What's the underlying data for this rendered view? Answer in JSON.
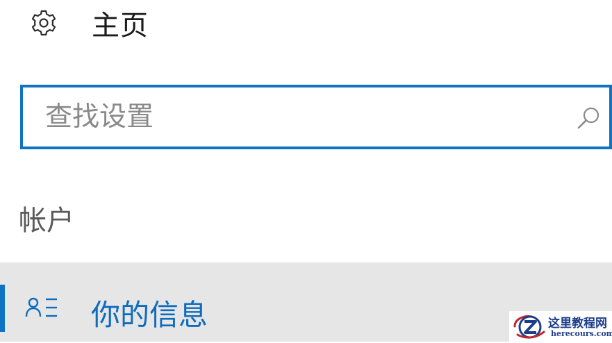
{
  "header": {
    "icon": "gear-icon",
    "title": "主页"
  },
  "search": {
    "placeholder": "查找设置",
    "value": "",
    "icon": "search-icon"
  },
  "section": {
    "label": "帐户"
  },
  "nav": {
    "items": [
      {
        "icon": "user-list-icon",
        "label": "你的信息",
        "selected": true
      }
    ]
  },
  "watermark": {
    "title": "这里教程网",
    "url": "herecours.com"
  },
  "colors": {
    "accent": "#0f72c2",
    "selected_background": "#e6e6e6",
    "selected_text": "#0f6cbd"
  }
}
